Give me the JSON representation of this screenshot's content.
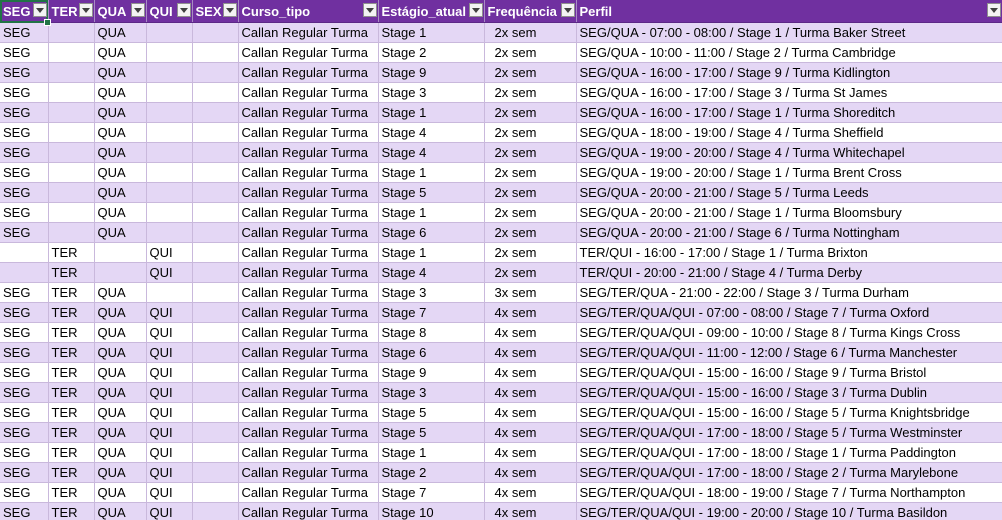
{
  "headers": [
    "SEG",
    "TER",
    "QUA",
    "QUI",
    "SEX",
    "Curso_tipo",
    "Estágio_atual",
    "Frequência",
    "Perfil"
  ],
  "rows": [
    [
      "SEG",
      "",
      "QUA",
      "",
      "",
      "Callan Regular Turma",
      "Stage 1",
      "2x sem",
      "SEG/QUA - 07:00 - 08:00  / Stage 1 / Turma Baker Street"
    ],
    [
      "SEG",
      "",
      "QUA",
      "",
      "",
      "Callan Regular Turma",
      "Stage 2",
      "2x sem",
      "SEG/QUA - 10:00 - 11:00  / Stage 2 / Turma Cambridge"
    ],
    [
      "SEG",
      "",
      "QUA",
      "",
      "",
      "Callan Regular Turma",
      "Stage 9",
      "2x sem",
      "SEG/QUA - 16:00 - 17:00  / Stage 9 / Turma Kidlington"
    ],
    [
      "SEG",
      "",
      "QUA",
      "",
      "",
      "Callan Regular Turma",
      "Stage 3",
      "2x sem",
      "SEG/QUA - 16:00 - 17:00  / Stage 3 / Turma St James"
    ],
    [
      "SEG",
      "",
      "QUA",
      "",
      "",
      "Callan Regular Turma",
      "Stage 1",
      "2x sem",
      "SEG/QUA - 16:00 - 17:00  / Stage 1 / Turma Shoreditch"
    ],
    [
      "SEG",
      "",
      "QUA",
      "",
      "",
      "Callan Regular Turma",
      "Stage 4",
      "2x sem",
      "SEG/QUA - 18:00 - 19:00  / Stage 4 / Turma Sheffield"
    ],
    [
      "SEG",
      "",
      "QUA",
      "",
      "",
      "Callan Regular Turma",
      "Stage 4",
      "2x sem",
      "SEG/QUA - 19:00 - 20:00  / Stage 4 / Turma Whitechapel"
    ],
    [
      "SEG",
      "",
      "QUA",
      "",
      "",
      "Callan Regular Turma",
      "Stage 1",
      "2x sem",
      "SEG/QUA - 19:00 - 20:00  / Stage 1 / Turma Brent Cross"
    ],
    [
      "SEG",
      "",
      "QUA",
      "",
      "",
      "Callan Regular Turma",
      "Stage 5",
      "2x sem",
      "SEG/QUA - 20:00 - 21:00  / Stage 5 / Turma Leeds"
    ],
    [
      "SEG",
      "",
      "QUA",
      "",
      "",
      "Callan Regular Turma",
      "Stage 1",
      "2x sem",
      "SEG/QUA - 20:00 - 21:00  / Stage 1 / Turma Bloomsbury"
    ],
    [
      "SEG",
      "",
      "QUA",
      "",
      "",
      "Callan Regular Turma",
      "Stage 6",
      "2x sem",
      "SEG/QUA - 20:00 - 21:00  / Stage 6 / Turma Nottingham"
    ],
    [
      "",
      "TER",
      "",
      "QUI",
      "",
      "Callan Regular Turma",
      "Stage 1",
      "2x sem",
      "TER/QUI - 16:00 - 17:00  / Stage 1 / Turma Brixton"
    ],
    [
      "",
      "TER",
      "",
      "QUI",
      "",
      "Callan Regular Turma",
      "Stage 4",
      "2x sem",
      "TER/QUI - 20:00 - 21:00  / Stage 4 / Turma Derby"
    ],
    [
      "SEG",
      "TER",
      "QUA",
      "",
      "",
      "Callan Regular Turma",
      "Stage 3",
      "3x sem",
      "SEG/TER/QUA - 21:00 - 22:00  / Stage 3 / Turma Durham"
    ],
    [
      "SEG",
      "TER",
      "QUA",
      "QUI",
      "",
      "Callan Regular Turma",
      "Stage 7",
      "4x sem",
      "SEG/TER/QUA/QUI - 07:00 - 08:00  / Stage 7 / Turma Oxford"
    ],
    [
      "SEG",
      "TER",
      "QUA",
      "QUI",
      "",
      "Callan Regular Turma",
      "Stage 8",
      "4x sem",
      "SEG/TER/QUA/QUI - 09:00 - 10:00  / Stage 8 / Turma Kings Cross"
    ],
    [
      "SEG",
      "TER",
      "QUA",
      "QUI",
      "",
      "Callan Regular Turma",
      "Stage 6",
      "4x sem",
      "SEG/TER/QUA/QUI - 11:00 - 12:00  / Stage 6 / Turma Manchester"
    ],
    [
      "SEG",
      "TER",
      "QUA",
      "QUI",
      "",
      "Callan Regular Turma",
      "Stage 9",
      "4x sem",
      "SEG/TER/QUA/QUI - 15:00 - 16:00  / Stage 9 / Turma Bristol"
    ],
    [
      "SEG",
      "TER",
      "QUA",
      "QUI",
      "",
      "Callan Regular Turma",
      "Stage 3",
      "4x sem",
      "SEG/TER/QUA/QUI - 15:00 - 16:00  / Stage 3 / Turma Dublin"
    ],
    [
      "SEG",
      "TER",
      "QUA",
      "QUI",
      "",
      "Callan Regular Turma",
      "Stage 5",
      "4x sem",
      "SEG/TER/QUA/QUI - 15:00 - 16:00  / Stage 5 / Turma Knightsbridge"
    ],
    [
      "SEG",
      "TER",
      "QUA",
      "QUI",
      "",
      "Callan Regular Turma",
      "Stage 5",
      "4x sem",
      "SEG/TER/QUA/QUI - 17:00 - 18:00  / Stage 5 / Turma Westminster"
    ],
    [
      "SEG",
      "TER",
      "QUA",
      "QUI",
      "",
      "Callan Regular Turma",
      "Stage 1",
      "4x sem",
      "SEG/TER/QUA/QUI - 17:00 - 18:00  / Stage 1 / Turma Paddington"
    ],
    [
      "SEG",
      "TER",
      "QUA",
      "QUI",
      "",
      "Callan Regular Turma",
      "Stage 2",
      "4x sem",
      "SEG/TER/QUA/QUI - 17:00 - 18:00  / Stage 2 / Turma Marylebone"
    ],
    [
      "SEG",
      "TER",
      "QUA",
      "QUI",
      "",
      "Callan Regular Turma",
      "Stage 7",
      "4x sem",
      "SEG/TER/QUA/QUI - 18:00 - 19:00  / Stage 7 / Turma Northampton"
    ],
    [
      "SEG",
      "TER",
      "QUA",
      "QUI",
      "",
      "Callan Regular Turma",
      "Stage 10",
      "4x sem",
      "SEG/TER/QUA/QUI - 19:00 - 20:00  / Stage 10 / Turma Basildon"
    ]
  ],
  "colors": {
    "header_bg": "#7030a0",
    "header_text": "#ffffff",
    "band": "#e4d7f5",
    "grid": "#c9b8dc",
    "selection": "#217346"
  },
  "icons": {
    "filter": "filter-dropdown-icon"
  }
}
